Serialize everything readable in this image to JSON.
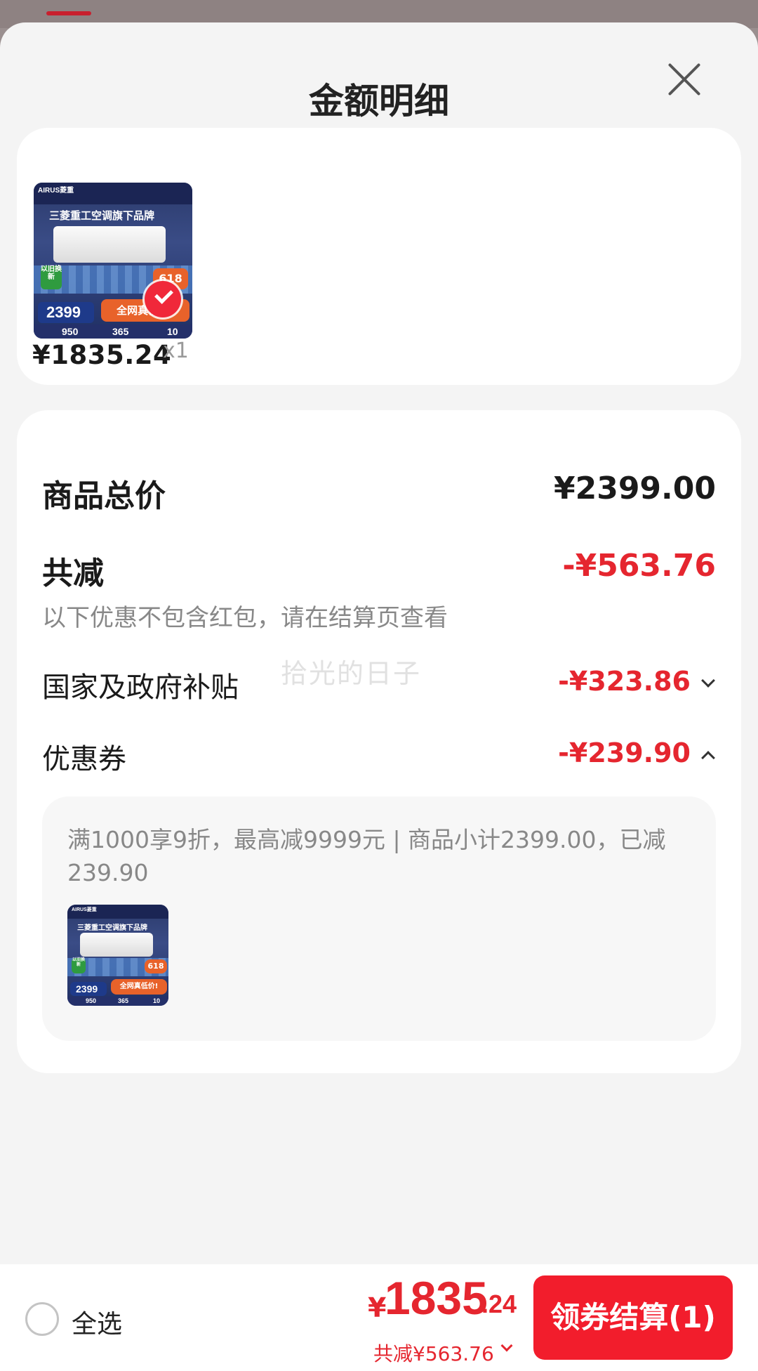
{
  "sheet": {
    "title": "金额明细",
    "watermark": "拾光的日子"
  },
  "product": {
    "thumbnail": {
      "brand": "AIRUS菱重",
      "headline": "三菱重工空调旗下品牌",
      "trade_in": "以旧换新",
      "event": "618",
      "promo": "全网真低价!",
      "price": "2399",
      "bottom_values": [
        "950",
        "365",
        "10"
      ]
    },
    "price": "¥1835.24",
    "quantity": "x1"
  },
  "detail": {
    "total_label": "商品总价",
    "total_value": "¥2399.00",
    "reduce_label": "共减",
    "reduce_value": "-¥563.76",
    "note": "以下优惠不包含红包，请在结算页查看",
    "subsidy_label": "国家及政府补贴",
    "subsidy_value": "-¥323.86",
    "coupon_label": "优惠券",
    "coupon_value": "-¥239.90",
    "coupon_desc": "满1000享9折，最高减9999元 | 商品小计2399.00，已减239.90"
  },
  "footer": {
    "select_all": "全选",
    "pay_symbol": "¥",
    "pay_integer": "1835",
    "pay_decimal": ".24",
    "reduced_summary": "共减¥563.76",
    "checkout_label": "领券结算(1)"
  },
  "colors": {
    "accent_red": "#e5262f",
    "button_red": "#f21d2c",
    "sheet_bg": "#f4f4f4"
  }
}
